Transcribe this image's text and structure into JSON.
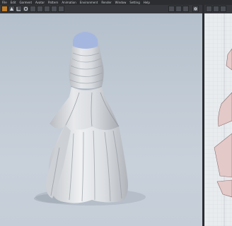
{
  "menu": [
    "File",
    "Edit",
    "Garment",
    "Avatar",
    "Pattern",
    "Animation",
    "Environment",
    "Render",
    "Window",
    "Setting",
    "Help"
  ],
  "icons": {
    "viewport_toolbar": [
      "select-icon",
      "move-icon",
      "gizmo-icon",
      "rotate-icon",
      "scale-icon",
      "fold-icon",
      "pin-icon",
      "tack-icon",
      "simulate-icon"
    ],
    "right_toolbar": [
      "view-2d-icon",
      "view-3d-icon",
      "arrange-icon",
      "settings-icon"
    ]
  },
  "colors": {
    "accent": "#c07d2a",
    "garment": "#dcdfe3",
    "avatar_skin": "#a6b7df",
    "pattern": "#e4c9c9"
  }
}
